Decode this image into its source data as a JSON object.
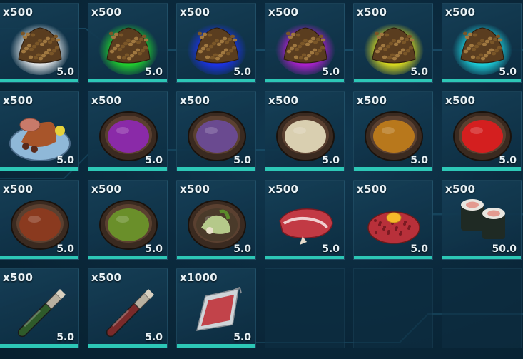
{
  "inventory": {
    "items": [
      {
        "name": "White Kibble",
        "qty": "x500",
        "weight": "5.0",
        "icon": "kibble-icon",
        "glow": "#ffffff"
      },
      {
        "name": "Green Kibble",
        "qty": "x500",
        "weight": "5.0",
        "icon": "kibble-icon",
        "glow": "#22e52a"
      },
      {
        "name": "Blue Kibble",
        "qty": "x500",
        "weight": "5.0",
        "icon": "kibble-icon",
        "glow": "#1e33ff"
      },
      {
        "name": "Purple Kibble",
        "qty": "x500",
        "weight": "5.0",
        "icon": "kibble-icon",
        "glow": "#c21ee0"
      },
      {
        "name": "Yellow Kibble",
        "qty": "x500",
        "weight": "5.0",
        "icon": "kibble-icon",
        "glow": "#f6f21a"
      },
      {
        "name": "Cyan Kibble",
        "qty": "x500",
        "weight": "5.0",
        "icon": "kibble-icon",
        "glow": "#1fe6f0"
      },
      {
        "name": "Cooked Meal Plate",
        "qty": "x500",
        "weight": "5.0",
        "icon": "meal-plate-icon",
        "glow": ""
      },
      {
        "name": "Purple Berry Bowl",
        "qty": "x500",
        "weight": "5.0",
        "icon": "bowl-icon",
        "fill": "#8a2aa8"
      },
      {
        "name": "Lavender Mash Bowl",
        "qty": "x500",
        "weight": "5.0",
        "icon": "bowl-icon",
        "fill": "#6a4a90"
      },
      {
        "name": "Cream Porridge Bowl",
        "qty": "x500",
        "weight": "5.0",
        "icon": "bowl-icon",
        "fill": "#d9cfb0"
      },
      {
        "name": "Amber Stew Bowl",
        "qty": "x500",
        "weight": "5.0",
        "icon": "bowl-icon",
        "fill": "#b8781c"
      },
      {
        "name": "Red Berry Bowl",
        "qty": "x500",
        "weight": "5.0",
        "icon": "bowl-icon",
        "fill": "#d41f1f"
      },
      {
        "name": "Brown Stew Bowl",
        "qty": "x500",
        "weight": "5.0",
        "icon": "bowl-icon",
        "fill": "#8a3a1f"
      },
      {
        "name": "Green Mash Bowl",
        "qty": "x500",
        "weight": "5.0",
        "icon": "bowl-icon",
        "fill": "#6a8f2a"
      },
      {
        "name": "Vegetable Bowl",
        "qty": "x500",
        "weight": "5.0",
        "icon": "veg-bowl-icon",
        "fill": "#b5c98a"
      },
      {
        "name": "Raw Steak",
        "qty": "x500",
        "weight": "5.0",
        "icon": "steak-icon",
        "fill": "#c23a44"
      },
      {
        "name": "Egg Tartare",
        "qty": "x500",
        "weight": "5.0",
        "icon": "tartare-icon",
        "fill": "#b8303a"
      },
      {
        "name": "Sushi Rolls",
        "qty": "x500",
        "weight": "50.0",
        "icon": "sushi-icon",
        "fill": "#e39a90"
      },
      {
        "name": "Green Bottle",
        "qty": "x500",
        "weight": "5.0",
        "icon": "bottle-icon",
        "fill": "#2f5a2a"
      },
      {
        "name": "Red Bottle",
        "qty": "x500",
        "weight": "5.0",
        "icon": "bottle-icon",
        "fill": "#7a2a2a"
      },
      {
        "name": "Blood Pack",
        "qty": "x1000",
        "weight": "5.0",
        "icon": "blood-pack-icon",
        "fill": "#c2434a"
      }
    ]
  },
  "colors": {
    "accent_bar": "#2dc7b6",
    "text": "#e8f2f6",
    "slot_bg": "#123a52"
  }
}
